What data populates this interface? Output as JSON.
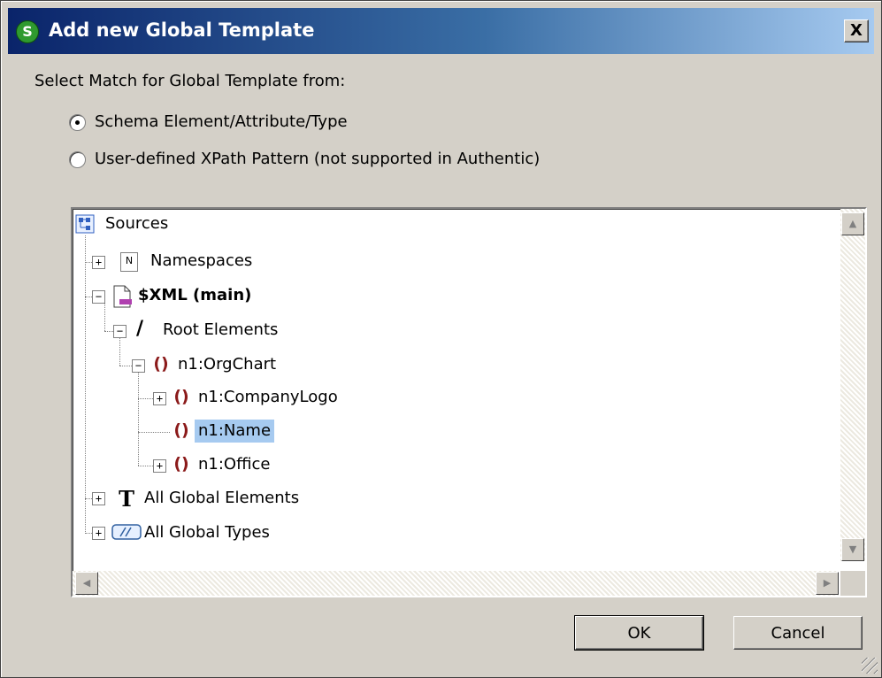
{
  "window": {
    "title": "Add new Global Template",
    "close_label": "X",
    "app_icon_letter": "S"
  },
  "prompt_label": "Select Match for Global Template from:",
  "options": [
    {
      "label": "Schema Element/Attribute/Type",
      "checked": true
    },
    {
      "label": "User-defined XPath Pattern (not supported in Authentic)",
      "checked": false
    }
  ],
  "tree": {
    "root_label": "Sources",
    "nodes": {
      "namespaces": {
        "label": "Namespaces",
        "expander": "+",
        "icon": "namespace-icon",
        "icon_glyph": "N"
      },
      "xml_main": {
        "label": "$XML (main)",
        "expander": "−",
        "icon": "document-icon"
      },
      "root_elements": {
        "label": "Root Elements",
        "expander": "−",
        "icon": "slash-icon",
        "icon_glyph": "/"
      },
      "orgchart": {
        "label": "n1:OrgChart",
        "expander": "−",
        "icon": "element-icon",
        "icon_glyph": "()"
      },
      "companylogo": {
        "label": "n1:CompanyLogo",
        "expander": "+",
        "icon": "element-icon",
        "icon_glyph": "()"
      },
      "name": {
        "label": "n1:Name",
        "selected": true,
        "icon": "element-icon",
        "icon_glyph": "()"
      },
      "office": {
        "label": "n1:Office",
        "expander": "+",
        "icon": "element-icon",
        "icon_glyph": "()"
      },
      "global_elements": {
        "label": "All Global Elements",
        "expander": "+",
        "icon": "type-t-icon",
        "icon_glyph": "T"
      },
      "global_types": {
        "label": "All Global Types",
        "expander": "+",
        "icon": "global-types-icon"
      }
    }
  },
  "buttons": {
    "ok": "OK",
    "cancel": "Cancel"
  },
  "colors": {
    "title_start": "#0a246a",
    "title_end": "#a6caf0",
    "selection": "#a6caf0",
    "face": "#d4d0c8",
    "element_icon": "#8b1a1a"
  }
}
